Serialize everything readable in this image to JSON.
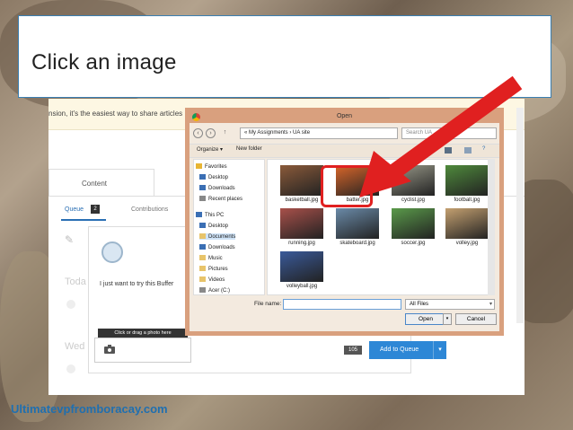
{
  "callout": {
    "text": "Click an image"
  },
  "background_page": {
    "banner_text": "nsion, it's the easiest way to share articles",
    "tabs": {
      "content": "Content"
    },
    "subtabs": {
      "queue": "Queue",
      "queue_count": "2",
      "contributions": "Contributions"
    },
    "ghost_labels": {
      "today": "Toda",
      "wed": "Wed"
    },
    "composer": {
      "text": "I just want to try this Buffer",
      "photo_hint": "Click or drag a photo here",
      "char_count": "105",
      "add_to_queue": "Add to Queue"
    }
  },
  "dialog": {
    "title": "Open",
    "address_path": "« My Assignments › UA site",
    "search_placeholder": "Search UA",
    "toolbar": {
      "organize": "Organize ▾",
      "new_folder": "New folder"
    },
    "tree": [
      {
        "label": "Favorites",
        "icon": "star-icon",
        "color": "#e8b533"
      },
      {
        "label": "Desktop",
        "icon": "desktop-icon",
        "color": "#3b6fb4"
      },
      {
        "label": "Downloads",
        "icon": "downloads-icon",
        "color": "#3b6fb4"
      },
      {
        "label": "Recent places",
        "icon": "recent-icon",
        "color": "#888888"
      },
      {
        "label": "This PC",
        "icon": "pc-icon",
        "color": "#3b6fb4"
      },
      {
        "label": "Desktop",
        "icon": "desktop-icon",
        "color": "#3b6fb4"
      },
      {
        "label": "Documents",
        "icon": "folder-icon",
        "color": "#e8c46a"
      },
      {
        "label": "Downloads",
        "icon": "downloads-icon",
        "color": "#3b6fb4"
      },
      {
        "label": "Music",
        "icon": "music-icon",
        "color": "#e8c46a"
      },
      {
        "label": "Pictures",
        "icon": "pictures-icon",
        "color": "#e8c46a"
      },
      {
        "label": "Videos",
        "icon": "videos-icon",
        "color": "#e8c46a"
      },
      {
        "label": "Acer (C:)",
        "icon": "drive-icon",
        "color": "#8a8a8a"
      }
    ],
    "files": [
      {
        "name": "basketball.jpg",
        "color": "#8a5a3a"
      },
      {
        "name": "batter.jpg",
        "color": "#d9662a"
      },
      {
        "name": "cyclist.jpg",
        "color": "#9a9a8a"
      },
      {
        "name": "football.jpg",
        "color": "#4f8a3c"
      },
      {
        "name": "running.jpg",
        "color": "#a8504a"
      },
      {
        "name": "skateboard.jpg",
        "color": "#6a8aa8"
      },
      {
        "name": "soccer.jpg",
        "color": "#5a9a4a"
      },
      {
        "name": "volley.jpg",
        "color": "#c4a070"
      },
      {
        "name": "volleyball.jpg",
        "color": "#3a5a9a"
      }
    ],
    "file_name_label": "File name:",
    "file_type": "All Files",
    "open_label": "Open",
    "cancel_label": "Cancel"
  },
  "footer": {
    "brand": "Ultimatevpfromboracay.com"
  },
  "colors": {
    "accent": "#2d87d6",
    "highlight": "#e02020",
    "brand": "#1f6fb0"
  }
}
